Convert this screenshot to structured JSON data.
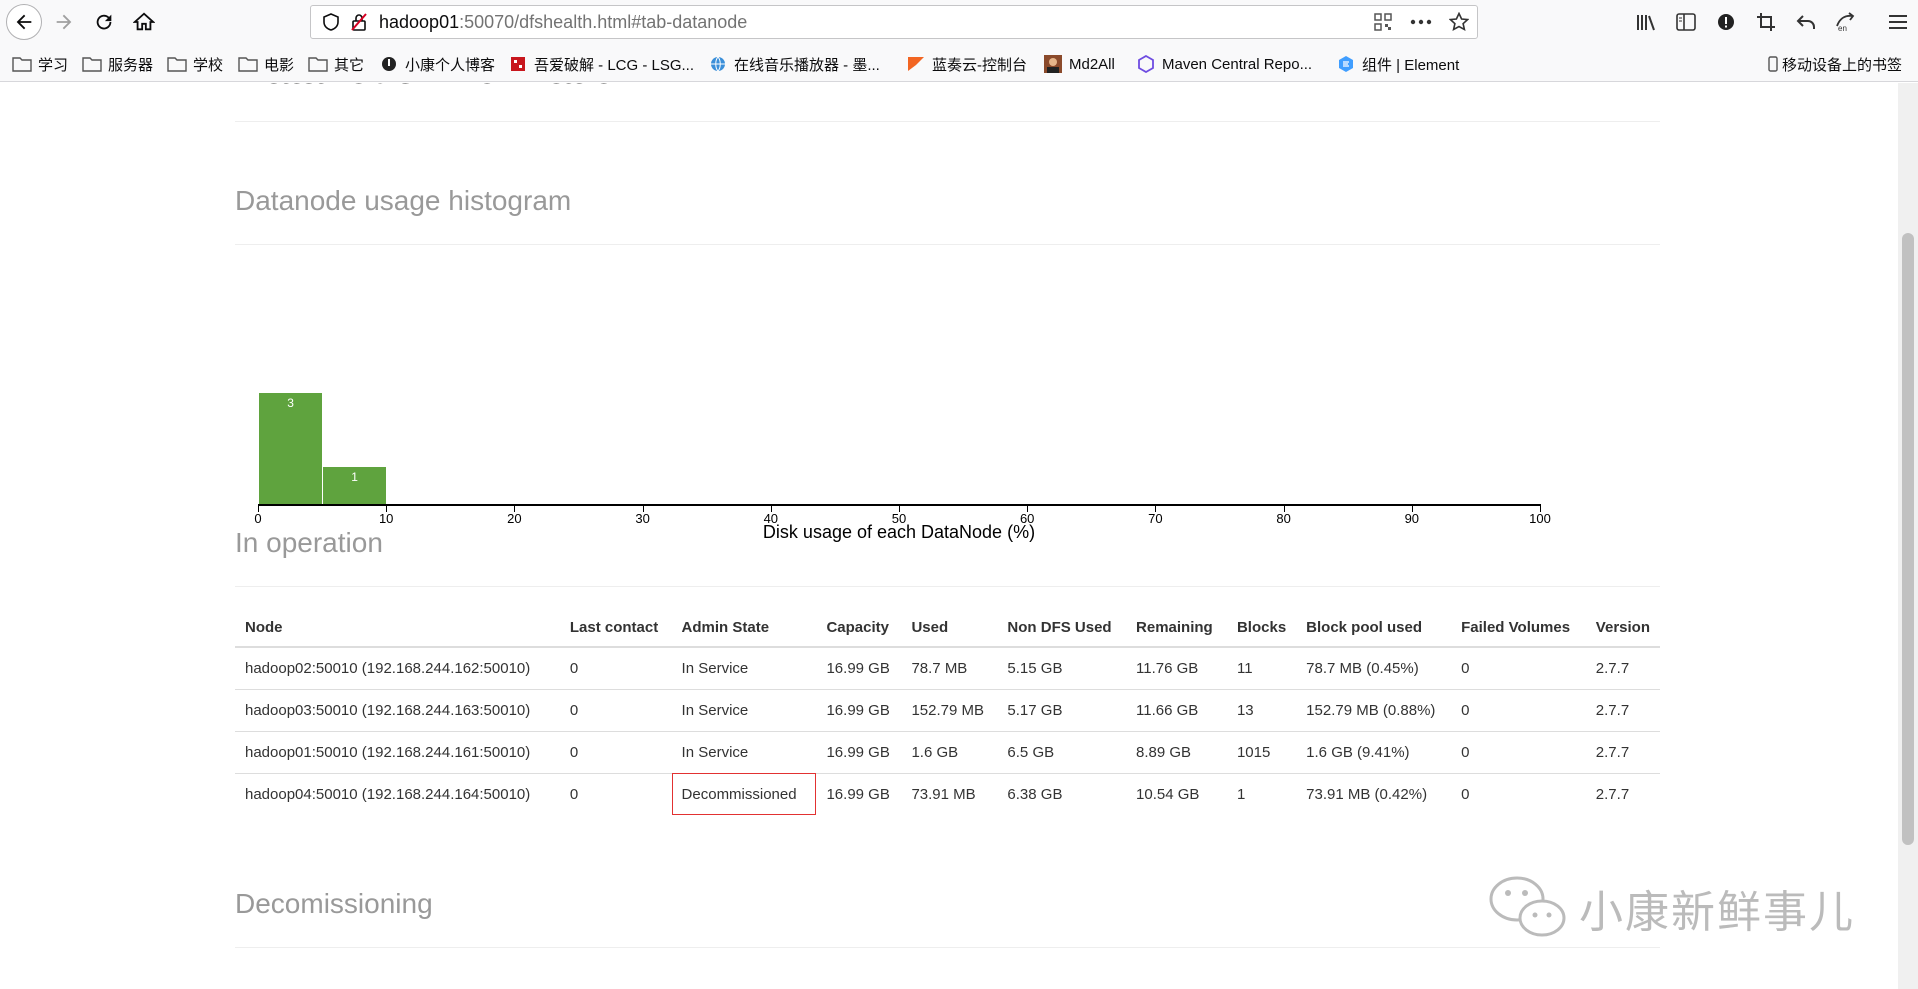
{
  "browser": {
    "url_host": "hadoop01",
    "url_path": ":50070/dfshealth.html#tab-datanode"
  },
  "bookmarks": [
    {
      "label": "学习",
      "icon": "folder-icon"
    },
    {
      "label": "服务器",
      "icon": "folder-icon"
    },
    {
      "label": "学校",
      "icon": "folder-icon"
    },
    {
      "label": "电影",
      "icon": "folder-icon"
    },
    {
      "label": "其它",
      "icon": "folder-icon"
    },
    {
      "label": "小康个人博客",
      "icon": "blog-icon"
    },
    {
      "label": "吾爱破解 - LCG - LSG...",
      "icon": "site-icon"
    },
    {
      "label": "在线音乐播放器 - 墨...",
      "icon": "globe-icon"
    },
    {
      "label": "蓝奏云-控制台",
      "icon": "flag-icon"
    },
    {
      "label": "Md2All",
      "icon": "avatar-icon"
    },
    {
      "label": "Maven Central Repo...",
      "icon": "hexagon-icon"
    },
    {
      "label": "组件 | Element",
      "icon": "element-icon"
    }
  ],
  "mobile_bookmarks": "移动设备上的书签",
  "page": {
    "top_heading": "Datanode Information",
    "histogram_title": "Datanode usage histogram",
    "in_operation_title": "In operation",
    "decommissioning_title": "Decomissioning"
  },
  "chart_data": {
    "type": "bar",
    "xlabel": "Disk usage of each DataNode (%)",
    "xlim": [
      0,
      100
    ],
    "x_ticks": [
      0,
      10,
      20,
      30,
      40,
      50,
      60,
      70,
      80,
      90,
      100
    ],
    "bins": [
      {
        "x0": 0,
        "x1": 5,
        "value": 3
      },
      {
        "x0": 5,
        "x1": 10,
        "value": 1
      }
    ],
    "bar_color": "#5fa33e"
  },
  "table": {
    "headers": [
      "Node",
      "Last contact",
      "Admin State",
      "Capacity",
      "Used",
      "Non DFS Used",
      "Remaining",
      "Blocks",
      "Block pool used",
      "Failed Volumes",
      "Version"
    ],
    "rows": [
      [
        "hadoop02:50010 (192.168.244.162:50010)",
        "0",
        "In Service",
        "16.99 GB",
        "78.7 MB",
        "5.15 GB",
        "11.76 GB",
        "11",
        "78.7 MB (0.45%)",
        "0",
        "2.7.7"
      ],
      [
        "hadoop03:50010 (192.168.244.163:50010)",
        "0",
        "In Service",
        "16.99 GB",
        "152.79 MB",
        "5.17 GB",
        "11.66 GB",
        "13",
        "152.79 MB (0.88%)",
        "0",
        "2.7.7"
      ],
      [
        "hadoop01:50010 (192.168.244.161:50010)",
        "0",
        "In Service",
        "16.99 GB",
        "1.6 GB",
        "6.5 GB",
        "8.89 GB",
        "1015",
        "1.6 GB (9.41%)",
        "0",
        "2.7.7"
      ],
      [
        "hadoop04:50010 (192.168.244.164:50010)",
        "0",
        "Decommissioned",
        "16.99 GB",
        "73.91 MB",
        "6.38 GB",
        "10.54 GB",
        "1",
        "73.91 MB (0.42%)",
        "0",
        "2.7.7"
      ]
    ]
  },
  "watermark": "小康新鲜事儿"
}
